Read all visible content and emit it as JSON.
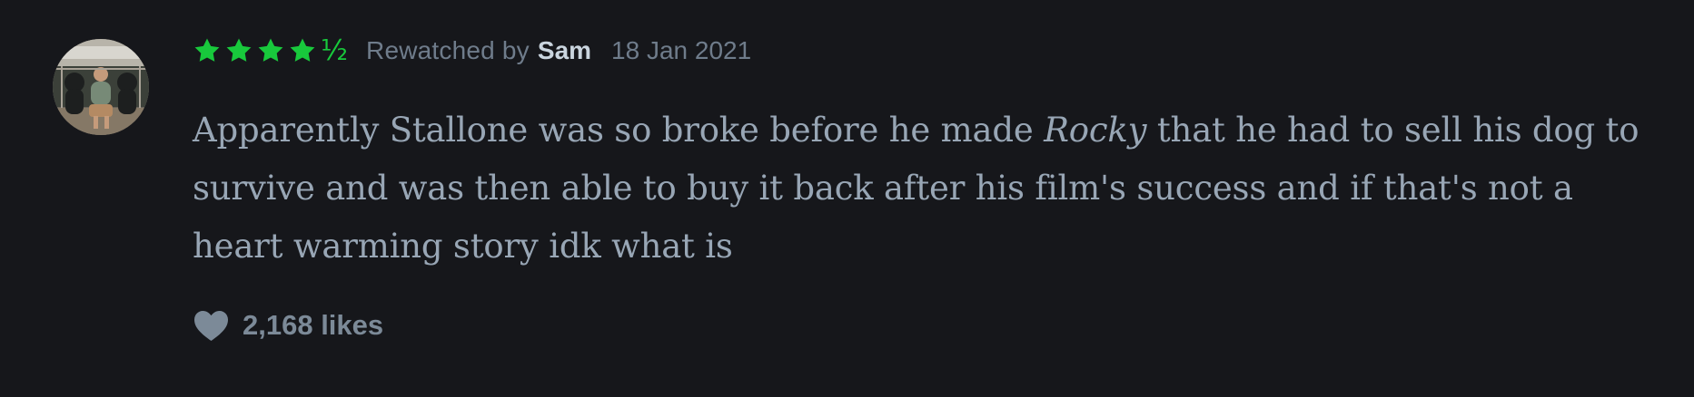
{
  "review": {
    "rating_stars": 4.5,
    "rating_half_symbol": "½",
    "action": "Rewatched by",
    "author": "Sam",
    "date": "18 Jan 2021",
    "body_before": "Apparently Stallone was so broke before he made ",
    "body_title": "Rocky",
    "body_after": " that he had to sell his dog to survive and was then able to buy it back after his film's success and if that's not a heart warming story idk what is",
    "likes": "2,168 likes"
  },
  "colors": {
    "background": "#16171b",
    "star": "#18c93c",
    "meta": "#6f7c8b",
    "author": "#cad5df",
    "body": "#98a6b5",
    "likes": "#7c8a98"
  },
  "icons": {
    "avatar": "profile-photo",
    "star": "star-icon",
    "heart": "heart-icon"
  }
}
